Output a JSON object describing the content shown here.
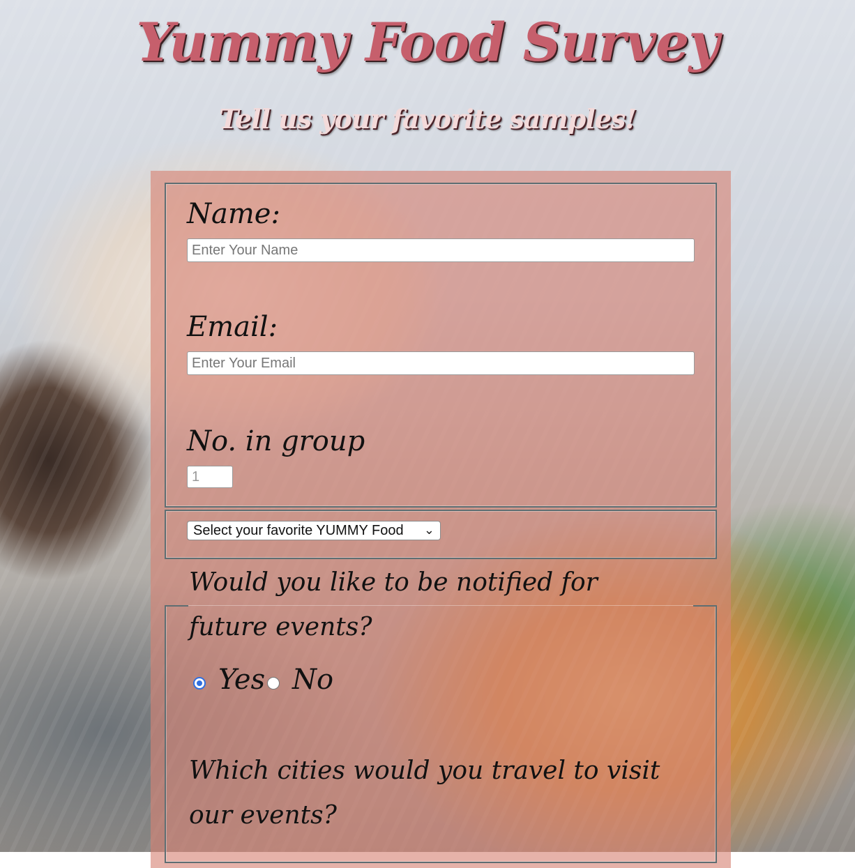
{
  "header": {
    "title": "Yummy Food Survey",
    "subtitle": "Tell us your favorite samples!"
  },
  "form": {
    "name": {
      "label": "Name:",
      "placeholder": "Enter Your Name"
    },
    "email": {
      "label": "Email:",
      "placeholder": "Enter Your Email"
    },
    "group": {
      "label": "No. in group",
      "value": "1"
    },
    "food_select": {
      "selected": "Select your favorite YUMMY Food"
    },
    "notify": {
      "question": "Would you like to be notified for future events?",
      "options": [
        {
          "label": "Yes",
          "checked": true
        },
        {
          "label": "No",
          "checked": false
        }
      ]
    },
    "cities": {
      "question": "Which cities would you travel to visit our events?"
    }
  },
  "colors": {
    "title": "#c65f6c",
    "panel": "#d68275",
    "radio_accent": "#2f6fe0"
  }
}
